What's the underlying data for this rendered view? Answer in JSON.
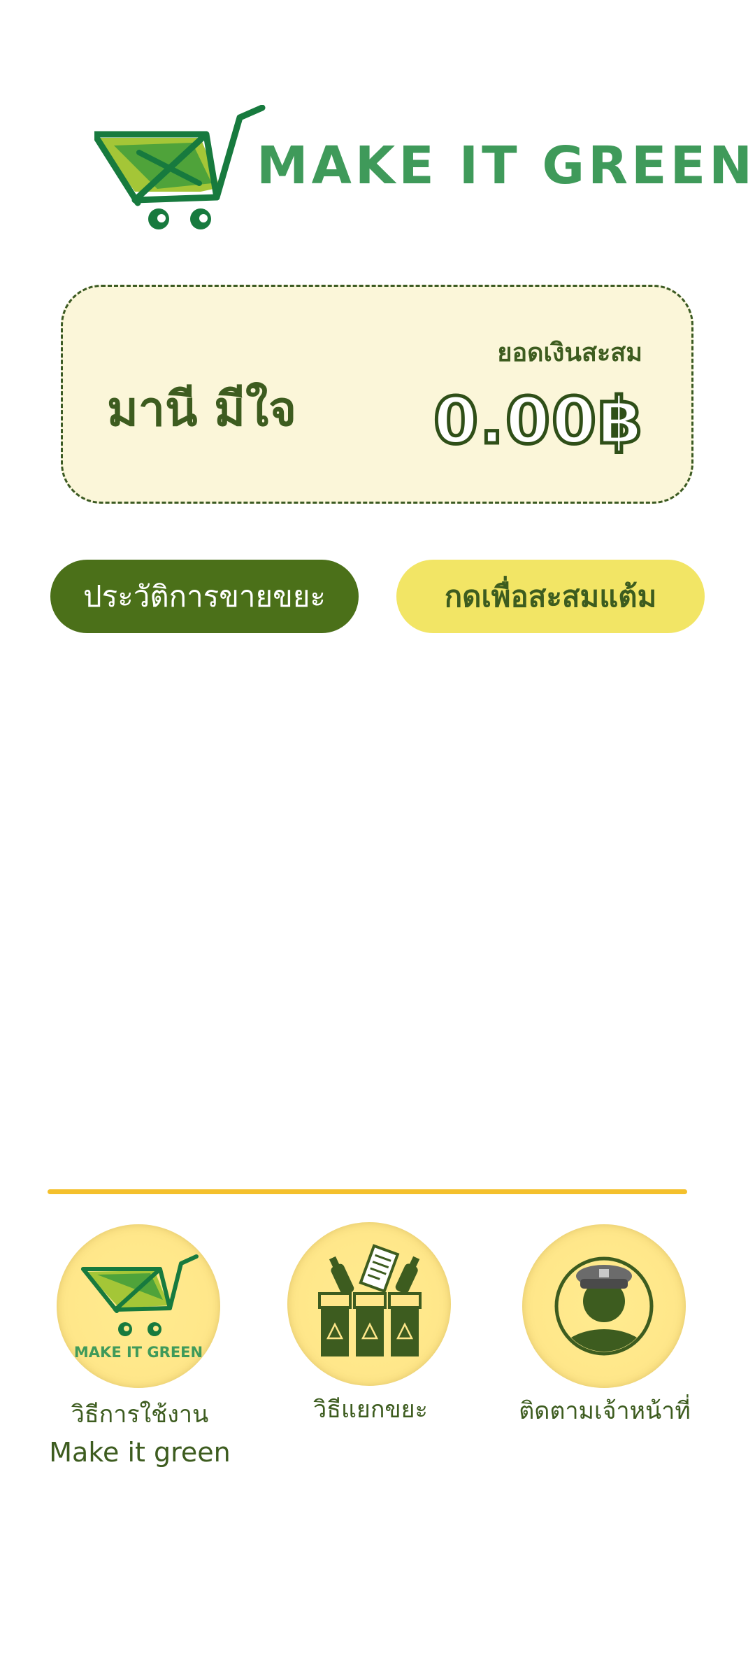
{
  "logo": {
    "text": "MAKE IT GREEN",
    "icon": "shopping-cart-icon"
  },
  "balance_card": {
    "user_name": "มานี มีใจ",
    "balance_label": "ยอดเงินสะสม",
    "balance_amount": "0.00฿"
  },
  "actions": {
    "history_label": "ประวัติการขายขยะ",
    "collect_points_label": "กดเพื่อสะสมแต้ม"
  },
  "menu": {
    "items": [
      {
        "icon": "make-it-green-logo-icon",
        "icon_text": "MAKE IT GREEN",
        "label_line1": "วิธีการใช้งาน",
        "label_line2": "Make it green"
      },
      {
        "icon": "recycling-bins-icon",
        "label_line1": "วิธีแยกขยะ"
      },
      {
        "icon": "officer-icon",
        "label_line1": "ติดตามเจ้าหน้าที่"
      }
    ]
  },
  "colors": {
    "brand_green": "#3f9a5a",
    "dark_green": "#3d5c1f",
    "button_green": "#4b7019",
    "button_yellow": "#f2e565",
    "card_bg": "#fbf6d9",
    "divider": "#f4c02c",
    "circle_yellow": "#ffe78a"
  }
}
